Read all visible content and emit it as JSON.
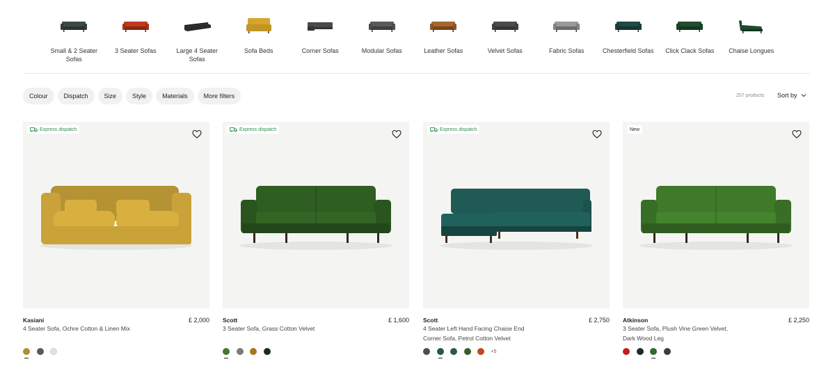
{
  "categories": [
    {
      "label": "Small & 2 Seater Sofas",
      "icon": "two-seater-sofa-icon",
      "color": "#3b4a45"
    },
    {
      "label": "3 Seater Sofas",
      "icon": "three-seater-sofa-icon",
      "color": "#c23a1e"
    },
    {
      "label": "Large 4 Seater Sofas",
      "icon": "large-sofa-icon",
      "color": "#2b2b2b"
    },
    {
      "label": "Sofa Beds",
      "icon": "sofa-bed-icon",
      "color": "#d6a52a"
    },
    {
      "label": "Corner Sofas",
      "icon": "corner-sofa-icon",
      "color": "#4a4a4a"
    },
    {
      "label": "Modular Sofas",
      "icon": "modular-sofa-icon",
      "color": "#5a5a5a"
    },
    {
      "label": "Leather Sofas",
      "icon": "leather-sofa-icon",
      "color": "#a8652e"
    },
    {
      "label": "Velvet Sofas",
      "icon": "velvet-sofa-icon",
      "color": "#4b4b4e"
    },
    {
      "label": "Fabric Sofas",
      "icon": "fabric-sofa-icon",
      "color": "#9a9a9a"
    },
    {
      "label": "Chesterfield Sofas",
      "icon": "chesterfield-sofa-icon",
      "color": "#1f4a45"
    },
    {
      "label": "Click Clack Sofas",
      "icon": "click-clack-sofa-icon",
      "color": "#1f4d2e"
    },
    {
      "label": "Chaise Longues",
      "icon": "chaise-longue-icon",
      "color": "#1e4a2e"
    }
  ],
  "filters": [
    "Colour",
    "Dispatch",
    "Size",
    "Style",
    "Materials",
    "More filters"
  ],
  "product_count": "257 products",
  "sort_label": "Sort by",
  "products": [
    {
      "badge": "Express dispatch",
      "badge_type": "express",
      "name": "Kasiani",
      "price": "£ 2,000",
      "desc1": "4 Seater Sofa, Ochre Cotton & Linen Mix",
      "desc2": "",
      "sofa_color": "#c9a33a",
      "sofa_shape": "slipcover",
      "swatches": [
        "#b0902e",
        "#5a5a58",
        "#e2e1dc"
      ],
      "selected_swatch": 0,
      "more": ""
    },
    {
      "badge": "Express dispatch",
      "badge_type": "express",
      "name": "Scott",
      "price": "£ 1,600",
      "desc1": "3 Seater Sofa, Grass Cotton Velvet",
      "desc2": "",
      "sofa_color": "#2f5e22",
      "sofa_shape": "straight",
      "swatches": [
        "#3f7a2e",
        "#7b7b78",
        "#a37a17",
        "#1c2b22"
      ],
      "selected_swatch": 0,
      "more": ""
    },
    {
      "badge": "Express dispatch",
      "badge_type": "express",
      "name": "Scott",
      "price": "£ 2,750",
      "desc1": "4 Seater Left Hand Facing Chaise End",
      "desc2": "Corner Sofa, Petrol Cotton Velvet",
      "sofa_color": "#1f5a55",
      "sofa_shape": "corner",
      "swatches": [
        "#4c4e4c",
        "#1f5a55",
        "#2e5a4e",
        "#3b5e25",
        "#c24a1e"
      ],
      "selected_swatch": 1,
      "more": "+5"
    },
    {
      "badge": "New",
      "badge_type": "new",
      "name": "Atkinson",
      "price": "£ 2,250",
      "desc1": "3 Seater Sofa, Plush Vine Green Velvet,",
      "desc2": "Dark Wood Leg",
      "sofa_color": "#3e7a2a",
      "sofa_shape": "straight",
      "swatches": [
        "#c21d1d",
        "#1c2b26",
        "#2f6a2a",
        "#3b3b3b"
      ],
      "selected_swatch": 2,
      "more": ""
    }
  ]
}
